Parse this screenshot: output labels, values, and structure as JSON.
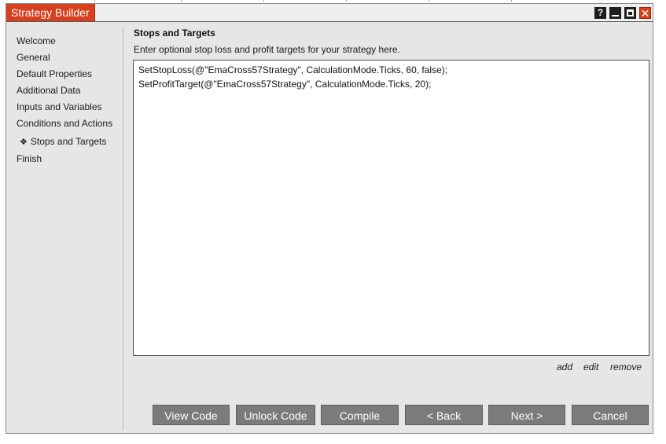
{
  "window": {
    "title": "Strategy Builder",
    "controls": {
      "help": "?",
      "close": "✕"
    }
  },
  "nav": {
    "items": [
      {
        "label": "Welcome"
      },
      {
        "label": "General"
      },
      {
        "label": "Default Properties"
      },
      {
        "label": "Additional Data"
      },
      {
        "label": "Inputs and Variables"
      },
      {
        "label": "Conditions and Actions"
      },
      {
        "label": "Stops and Targets",
        "active": true,
        "marker": "❖"
      },
      {
        "label": "Finish"
      }
    ]
  },
  "main": {
    "heading": "Stops and Targets",
    "description": "Enter optional stop loss and profit targets for your strategy here.",
    "code_lines": [
      "SetStopLoss(@\"EmaCross57Strategy\", CalculationMode.Ticks, 60, false);",
      "SetProfitTarget(@\"EmaCross57Strategy\", CalculationMode.Ticks, 20);"
    ],
    "actions": {
      "add": "add",
      "edit": "edit",
      "remove": "remove"
    }
  },
  "footer": {
    "view_code": "View Code",
    "unlock_code": "Unlock Code",
    "compile": "Compile",
    "back": "< Back",
    "next": "Next >",
    "cancel": "Cancel"
  },
  "colors": {
    "accent": "#d6401e",
    "button": "#7b7b7b",
    "panel": "#e6e6e6"
  }
}
